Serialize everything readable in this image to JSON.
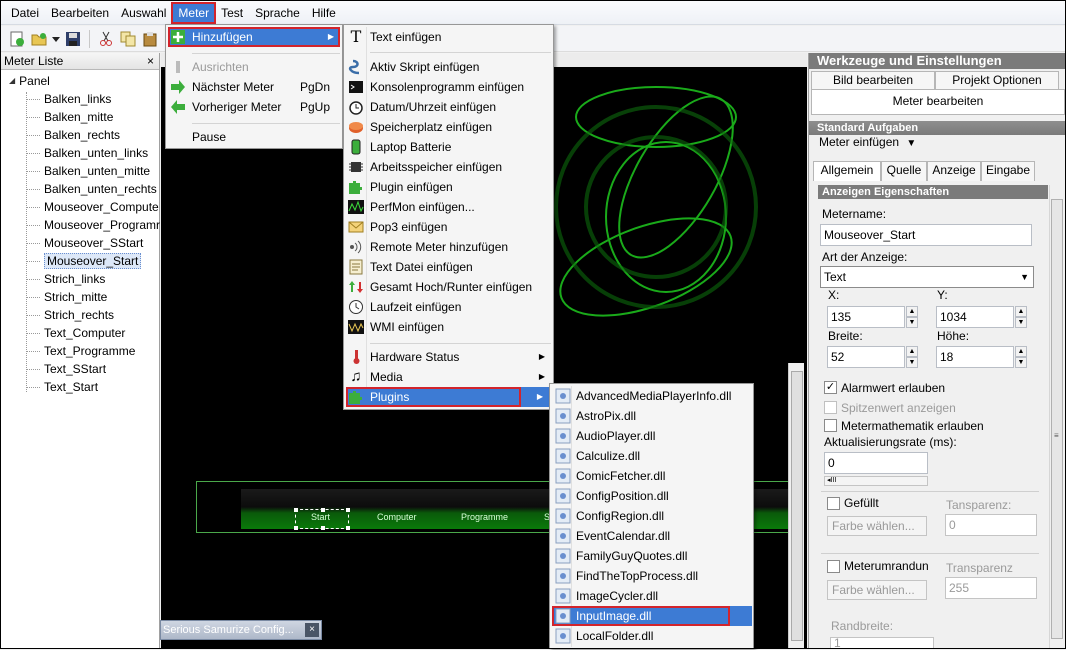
{
  "menubar": {
    "items": [
      "Datei",
      "Bearbeiten",
      "Auswahl",
      "Meter",
      "Test",
      "Sprache",
      "Hilfe"
    ],
    "active": "Meter"
  },
  "left_panel": {
    "title": "Meter Liste",
    "close": "×",
    "root": "Panel",
    "items": [
      "Balken_links",
      "Balken_mitte",
      "Balken_rechts",
      "Balken_unten_links",
      "Balken_unten_mitte",
      "Balken_unten_rechts",
      "Mouseover_Compute",
      "Mouseover_Programr",
      "Mouseover_SStart",
      "Mouseover_Start",
      "Strich_links",
      "Strich_mitte",
      "Strich_rechts",
      "Text_Computer",
      "Text_Programme",
      "Text_SStart",
      "Text_Start"
    ],
    "selected": "Mouseover_Start"
  },
  "canvas": {
    "bar_labels": [
      "Start",
      "Computer",
      "Programme",
      "S"
    ]
  },
  "taskbar_popup": {
    "title": "Serious Samurize Config...",
    "close": "×"
  },
  "meter_menu": {
    "items": [
      {
        "label": "Hinzufügen",
        "shortcut": "",
        "submenu": true
      },
      {
        "label": "Ausrichten",
        "shortcut": "",
        "disabled": true
      },
      {
        "label": "Nächster Meter",
        "shortcut": "PgDn"
      },
      {
        "label": "Vorheriger Meter",
        "shortcut": "PgUp"
      },
      {
        "label": "Pause",
        "shortcut": ""
      }
    ]
  },
  "add_menu": {
    "items": [
      "Text einfügen",
      "Aktiv Skript einfügen",
      "Konsolenprogramm einfügen",
      "Datum/Uhrzeit einfügen",
      "Speicherplatz einfügen",
      "Laptop Batterie",
      "Arbeitsspeicher einfügen",
      "Plugin einfügen",
      "PerfMon einfügen...",
      "Pop3 einfügen",
      "Remote Meter hinzufügen",
      "Text Datei einfügen",
      "Gesamt Hoch/Runter einfügen",
      "Laufzeit einfügen",
      "WMI einfügen",
      "Hardware Status",
      "Media",
      "Plugins"
    ]
  },
  "plugins_menu": {
    "items": [
      "AdvancedMediaPlayerInfo.dll",
      "AstroPix.dll",
      "AudioPlayer.dll",
      "Calculize.dll",
      "ComicFetcher.dll",
      "ConfigPosition.dll",
      "ConfigRegion.dll",
      "EventCalendar.dll",
      "FamilyGuyQuotes.dll",
      "FindTheTopProcess.dll",
      "ImageCycler.dll",
      "InputImage.dll",
      "LocalFolder.dll"
    ],
    "highlighted": "InputImage.dll"
  },
  "right_panel": {
    "title": "Werkzeuge und Einstellungen",
    "tabs": [
      "Bild bearbeiten",
      "Projekt Optionen"
    ],
    "subtab": "Meter bearbeiten",
    "standard_header": "Standard Aufgaben",
    "insert_meter": "Meter einfügen",
    "inner_tabs": [
      "Allgemein",
      "Quelle",
      "Anzeige",
      "Eingabe"
    ],
    "props_header": "Anzeigen Eigenschaften",
    "metername_label": "Metername:",
    "metername_value": "Mouseover_Start",
    "type_label": "Art der Anzeige:",
    "type_value": "Text",
    "x_label": "X:",
    "x_value": "135",
    "y_label": "Y:",
    "y_value": "1034",
    "width_label": "Breite:",
    "width_value": "52",
    "height_label": "Höhe:",
    "height_value": "18",
    "alarm_label": "Alarmwert erlauben",
    "peak_label": "Spitzenwert anzeigen",
    "math_label": "Metermathematik erlauben",
    "rate_label": "Aktualisierungsrate (ms):",
    "rate_value": "0",
    "filled_label": "Gefüllt",
    "transparency1_label": "Tansparenz:",
    "transparency1_value": "0",
    "color1_button": "Farbe wählen...",
    "border_label": "Meterumrandun",
    "transparency2_label": "Transparenz",
    "transparency2_value": "255",
    "color2_button": "Farbe wählen...",
    "border_width_label": "Randbreite:",
    "border_width_value": "1"
  },
  "colors": {
    "menu_highlight": "#3d7bd4",
    "red_outline": "#d2242c",
    "panel_header": "#7b7b7b",
    "canvas_bg": "#000000",
    "green_accent": "#0a7a0a"
  }
}
